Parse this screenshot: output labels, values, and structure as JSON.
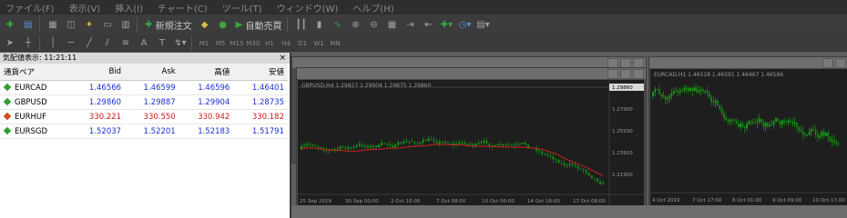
{
  "menu": {
    "file": "ファイル(F)",
    "view": "表示(V)",
    "insert": "挿入(I)",
    "chart": "チャート(C)",
    "tools": "ツール(T)",
    "window": "ウィンドウ(W)",
    "help": "ヘルプ(H)"
  },
  "toolbar": {
    "new_order": "新規注文",
    "auto_trading": "自動売買"
  },
  "timeframes": [
    "M1",
    "M5",
    "M15",
    "M30",
    "H1",
    "H4",
    "D1",
    "W1",
    "MN"
  ],
  "market_watch": {
    "title": "気配値表示: 11:21:11",
    "close": "×",
    "columns": {
      "symbol": "通貨ペア",
      "bid": "Bid",
      "ask": "Ask",
      "high": "高値",
      "low": "安値"
    },
    "rows": [
      {
        "symbol": "EURCAD",
        "bid": "1.46566",
        "ask": "1.46599",
        "high": "1.46596",
        "low": "1.46401",
        "dir": "up"
      },
      {
        "symbol": "GBPUSD",
        "bid": "1.29860",
        "ask": "1.29887",
        "high": "1.29904",
        "low": "1.28735",
        "dir": "up"
      },
      {
        "symbol": "EURHUF",
        "bid": "330.221",
        "ask": "330.550",
        "high": "330.942",
        "low": "330.182",
        "dir": "down"
      },
      {
        "symbol": "EURSGD",
        "bid": "1.52037",
        "ask": "1.52201",
        "high": "1.52183",
        "low": "1.51791",
        "dir": "up"
      }
    ]
  },
  "chart1": {
    "header": "GBPUSD,H4  1.29827 1.29904 1.29875 1.29860",
    "price_labels": [
      "1.29860",
      "1.27900",
      "1.25930",
      "1.23910",
      "1.21900"
    ],
    "time_labels": [
      "25 Sep 2019",
      "30 Sep 00:00",
      "2 Oct 16:00",
      "7 Oct 08:00",
      "10 Oct 00:00",
      "14 Oct 16:00",
      "17 Oct 08:00"
    ]
  },
  "chart2": {
    "header": "EURCAD,H1  1.46518 1.46591 1.46467 1.46566",
    "time_labels": [
      "4 Oct 2019",
      "7 Oct 17:00",
      "8 Oct 01:00",
      "9 Oct 09:00",
      "10 Oct 17:00"
    ]
  },
  "colors": {
    "bull": "#1aa51a",
    "bear": "#cc2020",
    "chart_bg": "#1e1e1e",
    "price_blue": "#1a2fd1",
    "price_red": "#cc1a1a"
  }
}
